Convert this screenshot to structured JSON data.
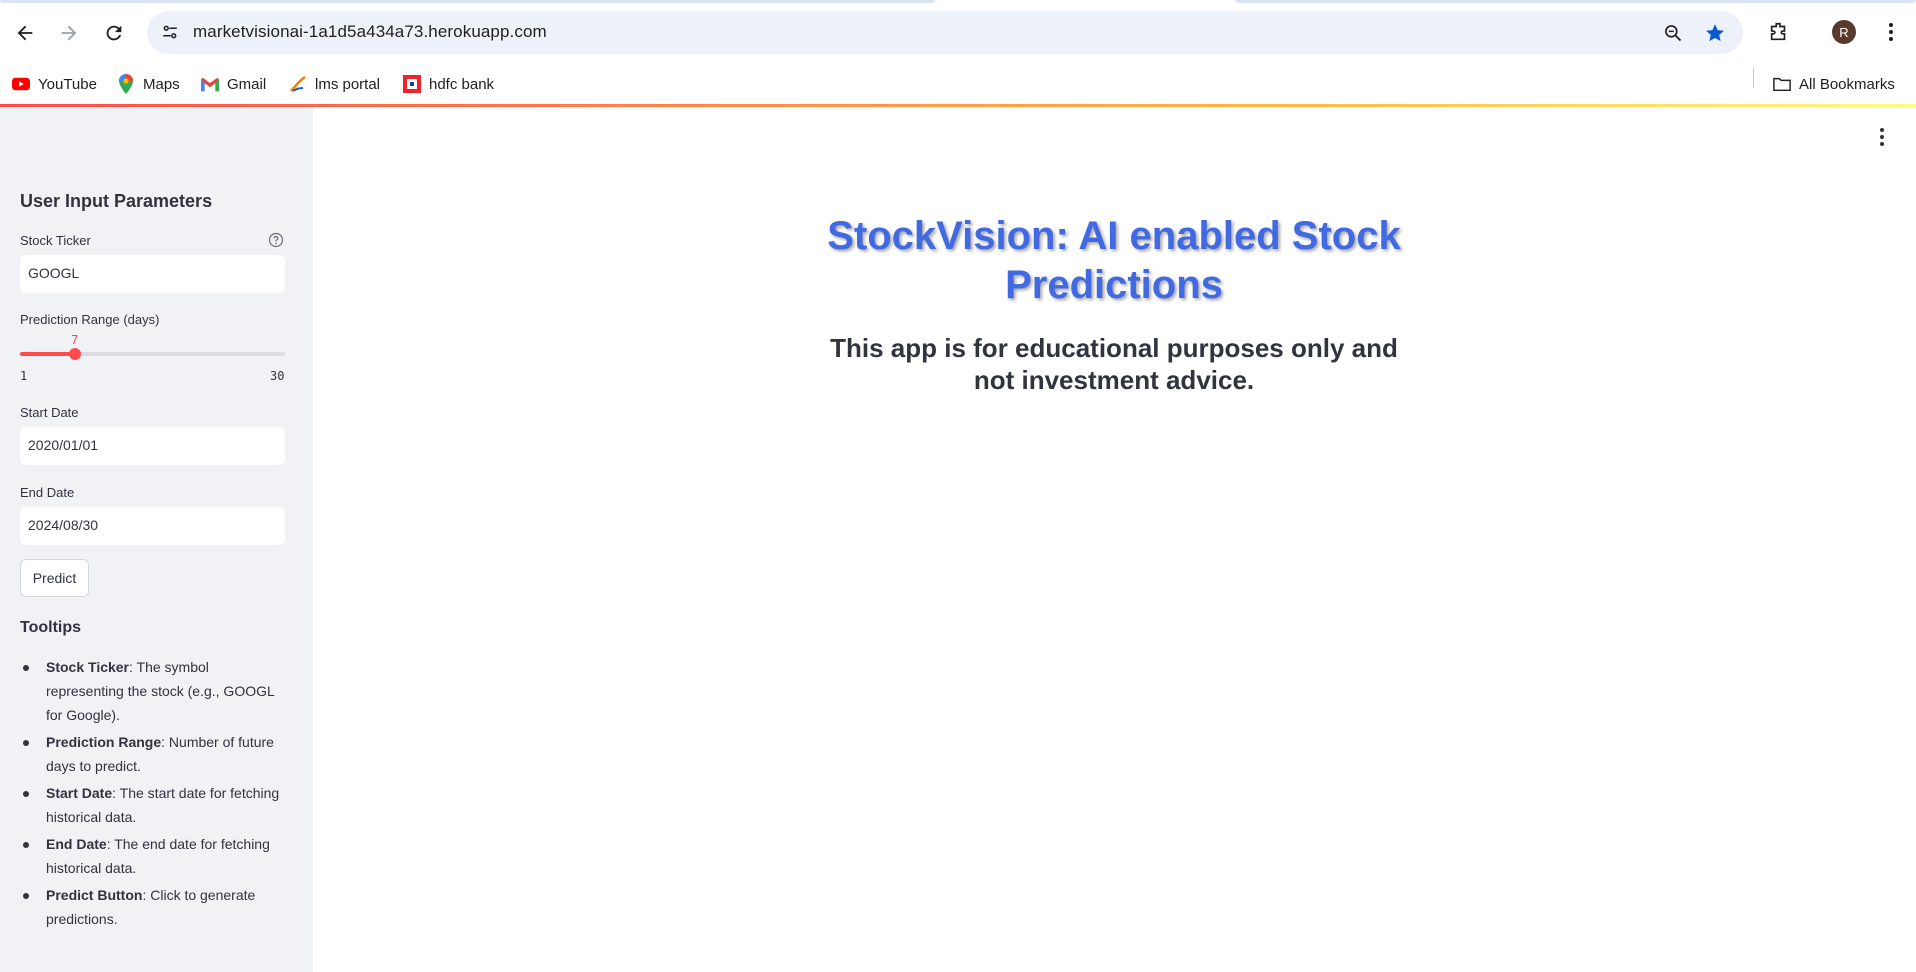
{
  "browser": {
    "url": "marketvisionai-1a1d5a434a73.herokuapp.com",
    "profile_initial": "R",
    "bookmarks": [
      {
        "label": "YouTube",
        "icon": "youtube-icon"
      },
      {
        "label": "Maps",
        "icon": "maps-icon"
      },
      {
        "label": "Gmail",
        "icon": "gmail-icon"
      },
      {
        "label": "lms portal",
        "icon": "lms-icon"
      },
      {
        "label": "hdfc bank",
        "icon": "hdfc-icon"
      }
    ],
    "all_bookmarks": "All Bookmarks"
  },
  "sidebar": {
    "title": "User Input Parameters",
    "ticker_label": "Stock Ticker",
    "ticker_value": "GOOGL",
    "range_label": "Prediction Range (days)",
    "range_value": "7",
    "range_min": "1",
    "range_max": "30",
    "start_label": "Start Date",
    "start_value": "2020/01/01",
    "end_label": "End Date",
    "end_value": "2024/08/30",
    "predict_label": "Predict",
    "tips_title": "Tooltips",
    "tips": [
      {
        "term": "Stock Ticker",
        "text": ": The symbol representing the stock (e.g., GOOGL for Google)."
      },
      {
        "term": "Prediction Range",
        "text": ": Number of future days to predict."
      },
      {
        "term": "Start Date",
        "text": ": The start date for fetching historical data."
      },
      {
        "term": "End Date",
        "text": ": The end date for fetching historical data."
      },
      {
        "term": "Predict Button",
        "text": ": Click to generate predictions."
      }
    ]
  },
  "main": {
    "title": "StockVision: AI enabled Stock Predictions",
    "disclaimer": "This app is for educational purposes only and not investment advice."
  },
  "colors": {
    "title": "#4169e1",
    "accent": "#ff4b4b",
    "sidebar_bg": "#f0f2f6"
  }
}
